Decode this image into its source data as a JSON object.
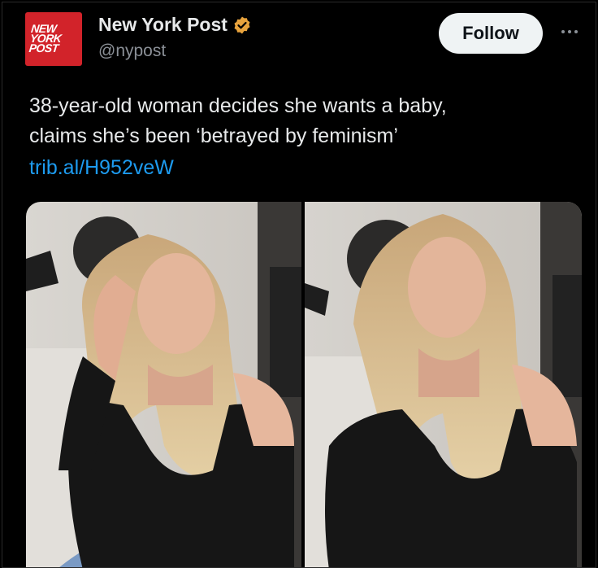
{
  "account": {
    "display_name": "New York Post",
    "handle": "@nypost",
    "avatar_logo": [
      "New",
      "York",
      "Post"
    ],
    "verified_color": "#e8a33d"
  },
  "actions": {
    "follow_label": "Follow",
    "more_icon": "more-horizontal-icon"
  },
  "post": {
    "text_lines": [
      "38-year-old woman decides she wants a baby,",
      "claims she’s been ‘betrayed by feminism’"
    ],
    "link": "trib.al/H952veW"
  },
  "media": {
    "images": [
      "woman-wiping-tear",
      "woman-crying-front"
    ]
  },
  "colors": {
    "background": "#000000",
    "text": "#e7e9ea",
    "secondary_text": "#8b9097",
    "link": "#1d9bf0",
    "brand_red": "#d2232a"
  }
}
